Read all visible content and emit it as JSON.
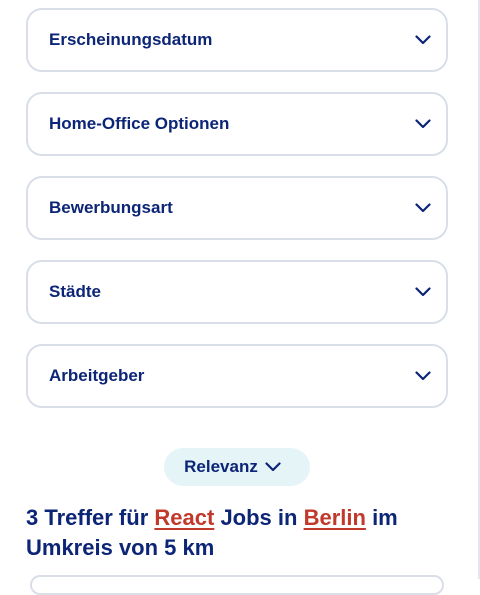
{
  "filters": [
    {
      "label": "Erscheinungsdatum"
    },
    {
      "label": "Home-Office Optionen"
    },
    {
      "label": "Bewerbungsart"
    },
    {
      "label": "Städte"
    },
    {
      "label": "Arbeitgeber"
    }
  ],
  "sort": {
    "label": "Relevanz"
  },
  "results": {
    "prefix": "3 Treffer für",
    "keyword": "React",
    "middle": "Jobs in",
    "city": "Berlin",
    "suffix": "im Umkreis von 5 km"
  },
  "icons": {
    "filter_chevron": "chevron-down-icon",
    "sort_chevron": "chevron-down-icon"
  },
  "colors": {
    "text": "#0c2577",
    "link": "#c0392b",
    "border": "#d9dee9",
    "sort_bg": "#e5f5f7"
  }
}
